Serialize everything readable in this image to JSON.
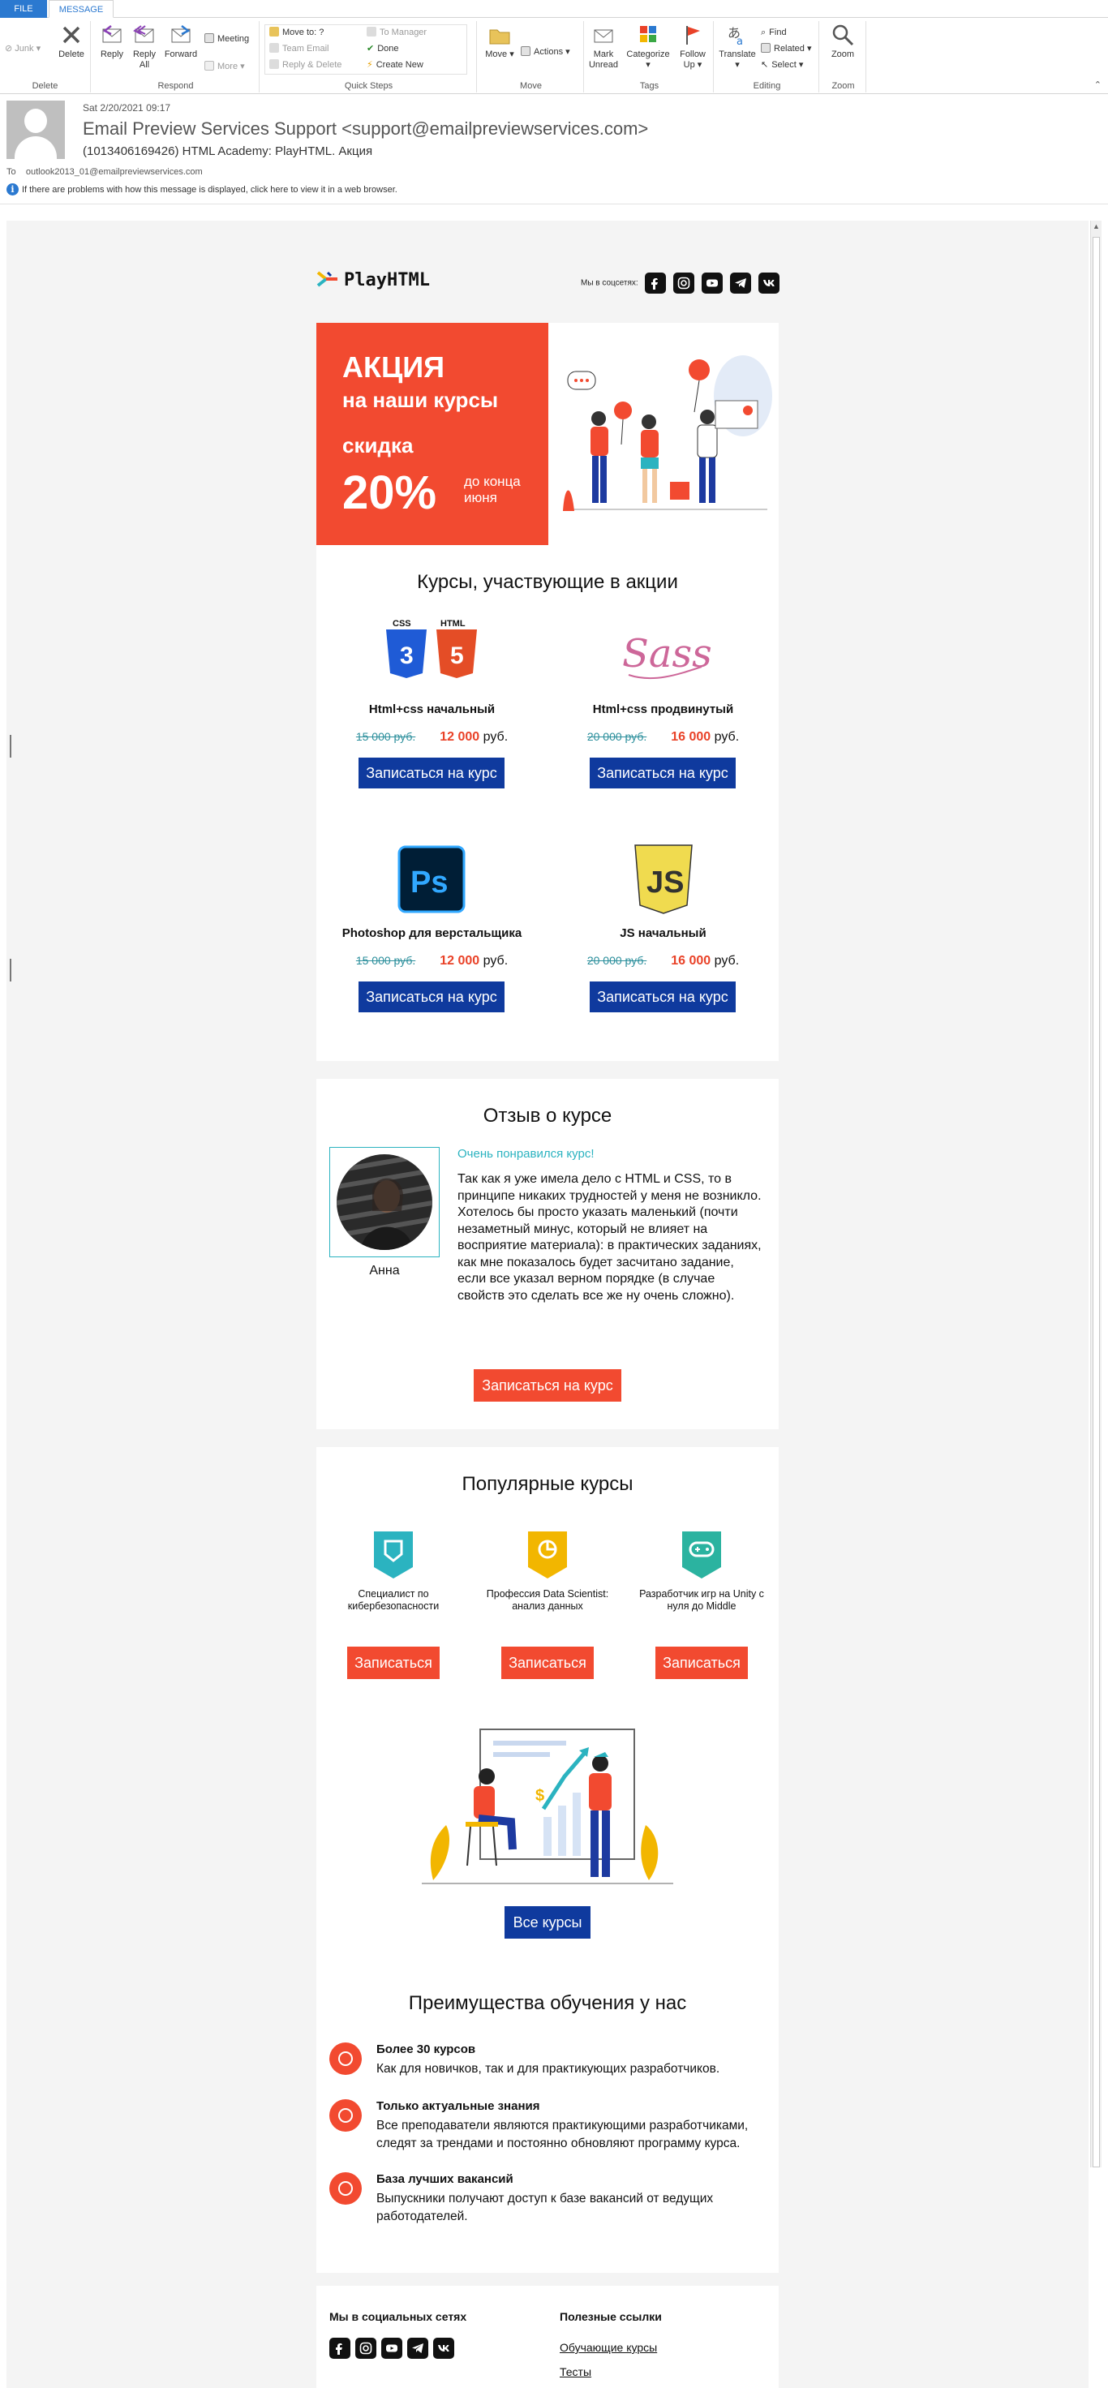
{
  "ribbon": {
    "tabs": [
      "FILE",
      "MESSAGE"
    ],
    "delete_group": {
      "label": "Delete",
      "junk": "Junk",
      "delete": "Delete"
    },
    "respond_group": {
      "label": "Respond",
      "reply": "Reply",
      "reply_all_1": "Reply",
      "reply_all_2": "All",
      "forward": "Forward",
      "meeting": "Meeting",
      "more": "More"
    },
    "quicksteps_group": {
      "label": "Quick Steps",
      "move_to": "Move to: ?",
      "team_email": "Team Email",
      "reply_delete": "Reply & Delete",
      "to_manager": "To Manager",
      "done": "Done",
      "create_new": "Create New"
    },
    "move_group": {
      "label": "Move",
      "move": "Move",
      "actions": "Actions"
    },
    "tags_group": {
      "label": "Tags",
      "mark_unread_1": "Mark",
      "mark_unread_2": "Unread",
      "categorize": "Categorize",
      "follow_up_1": "Follow",
      "follow_up_2": "Up"
    },
    "editing_group": {
      "label": "Editing",
      "translate": "Translate",
      "find": "Find",
      "related": "Related",
      "select": "Select"
    },
    "zoom_group": {
      "label": "Zoom",
      "zoom": "Zoom"
    }
  },
  "header": {
    "date": "Sat 2/20/2021 09:17",
    "from": "Email Preview Services Support <support@emailpreviewservices.com>",
    "subject": "(1013406169426) HTML Academy: PlayHTML. Акция",
    "to_label": "To",
    "to": "outlook2013_01@emailpreviewservices.com",
    "info": "If there are problems with how this message is displayed, click here to view it in a web browser."
  },
  "email": {
    "logo": "PlayHTML",
    "social_label": "Мы в соцсетях:",
    "hero": {
      "line1": "АКЦИЯ",
      "line2": "на наши курсы",
      "line3": "скидка",
      "percent": "20%",
      "until": "до конца июня"
    },
    "courses_title": "Курсы, участвующие в акции",
    "courses": [
      {
        "name": "Html+css начальный",
        "old": "15 000 руб.",
        "new": "12 000",
        "cur": "руб.",
        "btn": "Записаться на курс"
      },
      {
        "name": "Html+css продвинутый",
        "old": "20 000 руб.",
        "new": "16 000",
        "cur": "руб.",
        "btn": "Записаться на курс"
      },
      {
        "name": "Photoshop для верстальщика",
        "old": "15 000 руб.",
        "new": "12 000",
        "cur": "руб.",
        "btn": "Записаться на курс"
      },
      {
        "name": "JS начальный",
        "old": "20 000 руб.",
        "new": "16 000",
        "cur": "руб.",
        "btn": "Записаться на курс"
      }
    ],
    "icon_labels": {
      "css": "CSS",
      "html": "HTML",
      "sass": "Sass",
      "ps": "Ps",
      "js": "JS"
    },
    "review": {
      "title": "Отзыв о курсе",
      "name": "Анна",
      "quote": "Очень понравился курс!",
      "text": "Так как я уже имела дело с HTML и CSS, то в принципе никаких трудностей у меня не возникло. Хотелось бы просто указать маленький (почти незаметный минус, который не влияет на восприятие материала): в практических заданиях, как мне показалось будет засчитано задание, если все указал верном порядке (в случае свойств это сделать все же ну очень сложно).",
      "btn": "Записаться на курс"
    },
    "popular": {
      "title": "Популярные курсы",
      "items": [
        {
          "name": "Специалист по кибербезопасности",
          "btn": "Записаться"
        },
        {
          "name": "Профессия Data Scientist: анализ данных",
          "btn": "Записаться"
        },
        {
          "name": "Разработчик игр на Unity с нуля до Middle",
          "btn": "Записаться"
        }
      ],
      "all_btn": "Все курсы"
    },
    "advantages": {
      "title": "Преимущества обучения у нас",
      "items": [
        {
          "title": "Более 30 курсов",
          "desc": "Как для новичков, так и для практикующих разработчиков."
        },
        {
          "title": "Только актуальные знания",
          "desc": "Все преподаватели являются практикующими разработчиками, следят за трендами и постоянно обновляют программу курса."
        },
        {
          "title": "База лучших вакансий",
          "desc": "Выпускники получают доступ к базе вакансий от ведущих работодателей."
        }
      ]
    },
    "footer": {
      "social_title": "Мы в социальных сетях",
      "links_title": "Полезные ссылки",
      "links": [
        "Обучающие курсы",
        "Тесты"
      ]
    }
  },
  "colors": {
    "accent_red": "#f24a30",
    "accent_blue": "#0f3a9e",
    "teal": "#2bb3c0",
    "outlook_blue": "#2b79d0"
  }
}
